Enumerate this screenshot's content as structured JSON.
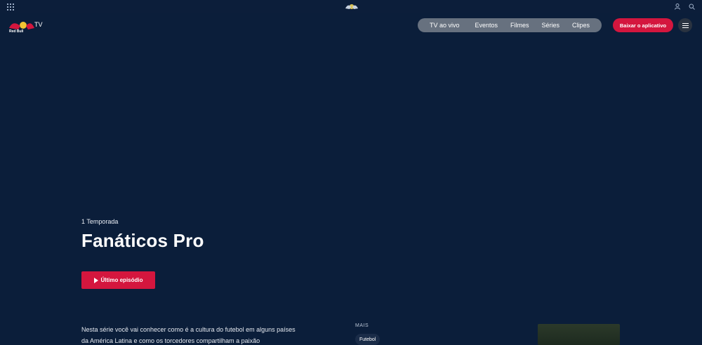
{
  "topbar": {
    "apps_icon": "apps-grid-icon",
    "center_logo": "redbull-logo-icon",
    "user_icon": "user-icon",
    "search_icon": "search-icon"
  },
  "brand": {
    "name": "Red Bull TV",
    "text": "TV"
  },
  "nav": {
    "items": [
      "TV ao vivo",
      "Eventos",
      "Filmes",
      "Séries",
      "Clipes"
    ]
  },
  "cta": {
    "label": "Baixar o aplicativo"
  },
  "menu": {
    "icon": "hamburger-icon"
  },
  "hero": {
    "season": "1 Temporada",
    "title": "Fanáticos Pro",
    "play_label": "Último episódio",
    "description": "Nesta série você vai conhecer como é a cultura do futebol em alguns países da América Latina e como os torcedores compartilham a paixão"
  },
  "more": {
    "label": "MAIS",
    "chip": "Futebol"
  },
  "colors": {
    "accent": "#d4163e",
    "background": "#0b1e3a"
  }
}
